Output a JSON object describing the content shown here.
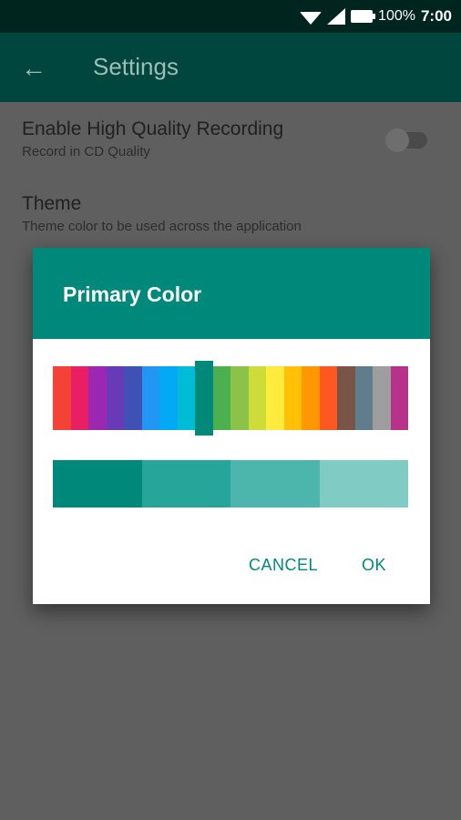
{
  "status_bar": {
    "battery": "100%",
    "time": "7:00"
  },
  "app_bar": {
    "title": "Settings",
    "background": "#00463f"
  },
  "preferences": [
    {
      "title": "Enable High Quality Recording",
      "summary": "Record in CD Quality",
      "toggle": false
    },
    {
      "title": "Theme",
      "summary": "Theme color to be used across the application"
    }
  ],
  "dialog": {
    "title": "Primary Color",
    "header_color": "#00897b",
    "palette": [
      "#f44336",
      "#e91e63",
      "#9c27b0",
      "#673ab7",
      "#3f51b5",
      "#2196f3",
      "#03a9f4",
      "#00bcd4",
      "#009688",
      "#4caf50",
      "#8bc34a",
      "#cddc39",
      "#ffeb3b",
      "#ffc107",
      "#ff9800",
      "#ff5722",
      "#795548",
      "#607d8b",
      "#9e9e9e",
      "#b7338b"
    ],
    "selected_index": 8,
    "selected_color": "#00897b",
    "shades": [
      "#00897b",
      "#26a69a",
      "#4db6ac",
      "#80cbc4"
    ],
    "cancel_label": "CANCEL",
    "ok_label": "OK"
  }
}
